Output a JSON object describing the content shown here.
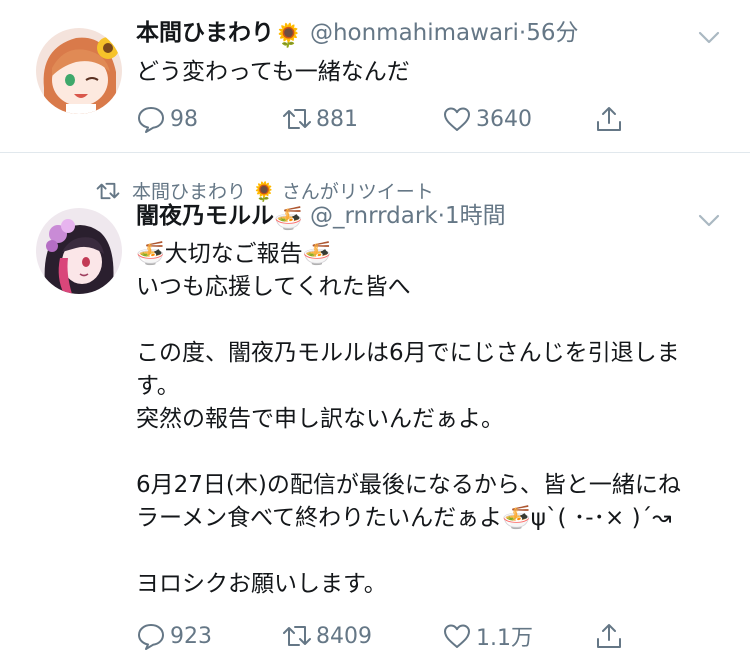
{
  "tweets": [
    {
      "display_name": "本間ひまわり",
      "name_emoji": "🌻",
      "handle": "@honmahimawari",
      "separator": "·",
      "time": "56分",
      "text": "どう変わっても一緒なんだ",
      "replies": "98",
      "retweets": "881",
      "likes": "3640"
    },
    {
      "retweet_context": "本間ひまわり 🌻 さんがリツイート",
      "display_name": "闇夜乃モルル",
      "name_emoji": "🍜",
      "handle": "@_rnrrdark",
      "separator": "·",
      "time": "1時間",
      "text": "🍜大切なご報告🍜\nいつも応援してくれた皆へ\n\nこの度、闇夜乃モルルは6月でにじさんじを引退しま\nす。\n突然の報告で申し訳ないんだぁよ。\n\n6月27日(木)の配信が最後になるから、皆と一緒にね\nラーメン食べて終わりたいんだぁよ🍜ψ`( ･-･× )´↝\n\nヨロシクお願いします。",
      "replies": "923",
      "retweets": "8409",
      "likes": "1.1万"
    }
  ],
  "icons": [
    "reply-icon",
    "retweet-icon",
    "like-icon",
    "share-icon",
    "chevron-down-icon"
  ],
  "colors": {
    "text": "#14171a",
    "secondary": "#657786",
    "divider": "#e1e8ed",
    "background": "#ffffff"
  }
}
